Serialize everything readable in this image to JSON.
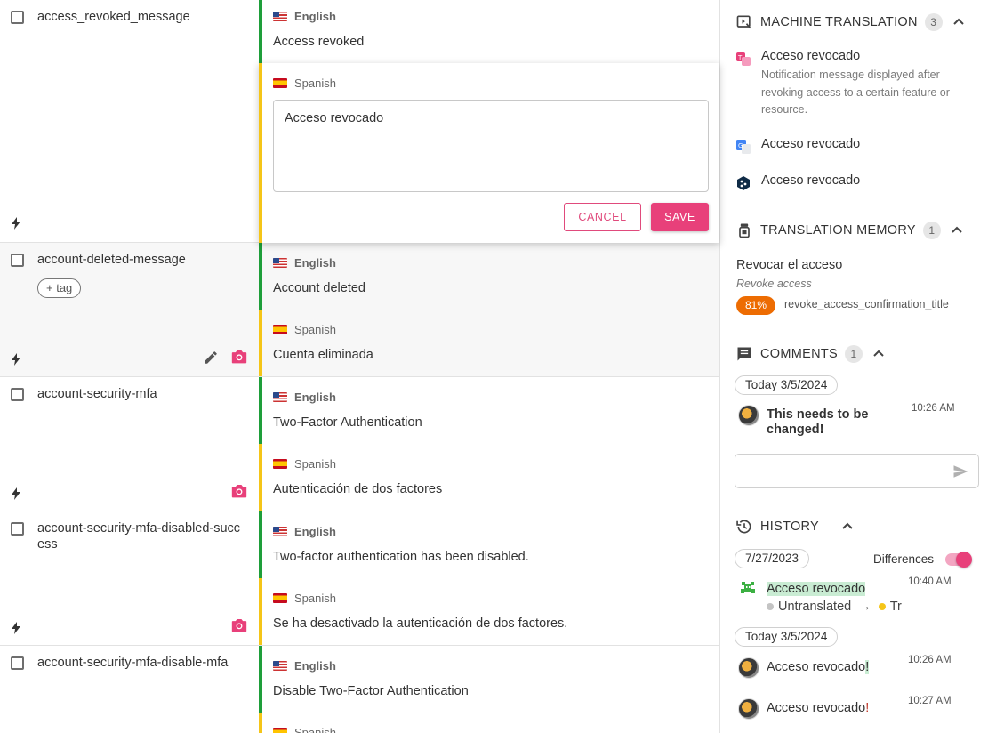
{
  "keys": [
    {
      "name": "access_revoked_message",
      "source_lang": "English",
      "source_text": "Access revoked",
      "target_lang": "Spanish",
      "target_text": "Acceso revocado"
    },
    {
      "name": "account-deleted-message",
      "tag_label": "+ tag",
      "source_lang": "English",
      "source_text": "Account deleted",
      "target_lang": "Spanish",
      "target_text": "Cuenta eliminada"
    },
    {
      "name": "account-security-mfa",
      "source_lang": "English",
      "source_text": "Two-Factor Authentication",
      "target_lang": "Spanish",
      "target_text": "Autenticación de dos factores"
    },
    {
      "name": "account-security-mfa-disabled-success",
      "source_lang": "English",
      "source_text": "Two-factor authentication has been disabled.",
      "target_lang": "Spanish",
      "target_text": "Se ha desactivado la autenticación de dos factores."
    },
    {
      "name": "account-security-mfa-disable-mfa",
      "source_lang": "English",
      "source_text": "Disable Two-Factor Authentication",
      "target_lang": "Spanish"
    }
  ],
  "editor": {
    "lang": "Spanish",
    "value": "Acceso revocado",
    "cancel_label": "CANCEL",
    "save_label": "SAVE"
  },
  "machine_translation": {
    "title": "MACHINE TRANSLATION",
    "count": "3",
    "items": [
      {
        "text": "Acceso revocado",
        "description": "Notification message displayed after revoking access to a certain feature or resource.",
        "icon": "ai-translator-icon"
      },
      {
        "text": "Acceso revocado",
        "icon": "google-translate-icon"
      },
      {
        "text": "Acceso revocado",
        "icon": "deepl-icon"
      }
    ]
  },
  "translation_memory": {
    "title": "TRANSLATION MEMORY",
    "count": "1",
    "target": "Revocar el acceso",
    "source": "Revoke access",
    "similarity": "81%",
    "key": "revoke_access_confirmation_title"
  },
  "comments": {
    "title": "COMMENTS",
    "count": "1",
    "date": "Today 3/5/2024",
    "items": [
      {
        "text": "This needs to be changed!",
        "time": "10:26 AM"
      }
    ],
    "input_placeholder": ""
  },
  "history": {
    "title": "HISTORY",
    "differences_label": "Differences",
    "differences_on": true,
    "groups": [
      {
        "date": "7/27/2023",
        "entries": [
          {
            "text": "Acceso revocado",
            "time": "10:40 AM",
            "from_state": "Untranslated",
            "arrow": "→",
            "to_state": "Tr"
          }
        ]
      },
      {
        "date": "Today 3/5/2024",
        "entries": [
          {
            "text": "Acceso revocado",
            "added": "!",
            "time": "10:26 AM"
          },
          {
            "text": "Acceso revocado",
            "added": "!",
            "time": "10:27 AM"
          }
        ]
      }
    ]
  },
  "colors": {
    "accent": "#e8407a",
    "reviewed_bar": "#1e9e3a",
    "translated_bar": "#f5c518",
    "tm_badge": "#ed6c02"
  }
}
